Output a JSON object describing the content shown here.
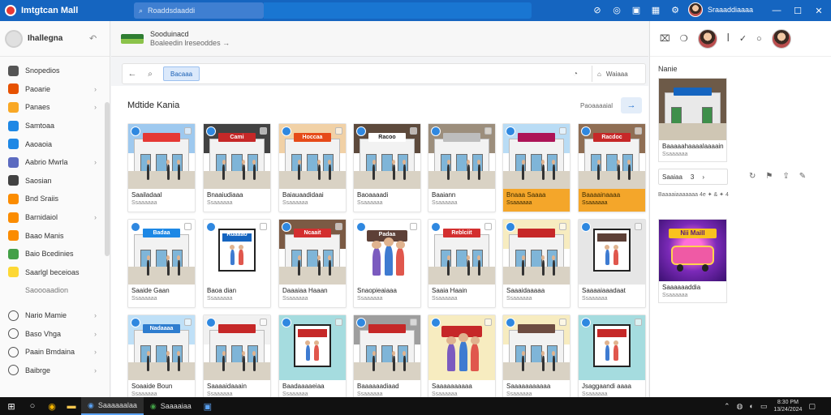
{
  "app": {
    "title": "Imtgtcan Mall"
  },
  "titlebar": {
    "search_text": "Roaddsdaaddi",
    "user_name": "Sraaaddiaaaa",
    "icons": [
      "shield-icon",
      "globe-icon",
      "puzzle-icon",
      "grid-icon",
      "gear-icon"
    ]
  },
  "sidebar": {
    "header": "Ihallegna",
    "items": [
      {
        "label": "Snopedios",
        "icon": "store-icon",
        "color": "#555555",
        "chev": false
      },
      {
        "label": "Paoarie",
        "icon": "person-icon",
        "color": "#e65100",
        "chev": true
      },
      {
        "label": "Panaes",
        "icon": "tag-icon",
        "color": "#f9a825",
        "chev": true
      },
      {
        "label": "Samtoaa",
        "icon": "calendar-icon",
        "color": "#1e88e5",
        "chev": false
      },
      {
        "label": "Aaoaoia",
        "icon": "info-icon",
        "color": "#1e88e5",
        "chev": false
      },
      {
        "label": "Aabrio Mwrla",
        "icon": "grid-icon",
        "color": "#5c6bc0",
        "chev": true
      },
      {
        "label": "Saosian",
        "icon": "people-icon",
        "color": "#424242",
        "chev": false
      },
      {
        "label": "Bnd Sraiis",
        "icon": "list-icon",
        "color": "#fb8c00",
        "chev": false
      },
      {
        "label": "Barnidaiol",
        "icon": "box-icon",
        "color": "#fb8c00",
        "chev": true
      },
      {
        "label": "Baao Manis",
        "icon": "map-icon",
        "color": "#fb8c00",
        "chev": false
      },
      {
        "label": "Baio Bcedinies",
        "icon": "bag-icon",
        "color": "#43a047",
        "chev": false
      },
      {
        "label": "Saarlgl beceioas",
        "icon": "chart-icon",
        "color": "#fdd835",
        "chev": false
      },
      {
        "label": "Saoooaadion",
        "icon": "",
        "color": "",
        "chev": false
      },
      {
        "label": "Nario Mamie",
        "icon": "circle-icon",
        "color": "#555555",
        "chev": true
      },
      {
        "label": "Baso Vhga",
        "icon": "globe-icon",
        "color": "#555555",
        "chev": true
      },
      {
        "label": "Paain Bmdaina",
        "icon": "star-icon",
        "color": "#fb8c00",
        "chev": true
      },
      {
        "label": "Baibrge",
        "icon": "check-icon",
        "color": "#555555",
        "chev": true
      }
    ]
  },
  "main": {
    "header_line1": "Sooduinacd",
    "header_line2": "Boaleedin  lreseoddes  →",
    "filter_chip": "Bacaaa",
    "segment_label": "Waiaaa",
    "section_title": "Mdtide Kania",
    "sort_label": "Paoaaaaial"
  },
  "cards": [
    {
      "title": "Saailadaal",
      "sub": "Ssaaaaaa",
      "sign": "#e53935",
      "sky": "#9ec9ef",
      "sign_text": "",
      "hl": false,
      "art": "store"
    },
    {
      "title": "Bnaaiudiaaa",
      "sub": "Ssaaaaaa",
      "sign": "#c62828",
      "sky": "#424242",
      "sign_text": "Cami",
      "hl": false,
      "art": "store"
    },
    {
      "title": "Baiauaadidaai",
      "sub": "Ssaaaaaa",
      "sign": "#e64a19",
      "sky": "#f1d1a6",
      "sign_text": "Hoccaa",
      "hl": false,
      "art": "store"
    },
    {
      "title": "Baoaaaadi",
      "sub": "Ssaaaaaa",
      "sign": "#ffffff",
      "sky": "#5d4a3c",
      "sign_text": "Racoo",
      "hl": false,
      "art": "store"
    },
    {
      "title": "Baaiann",
      "sub": "Ssaaaaaa",
      "sign": "#bdbdbd",
      "sky": "#9c8e7c",
      "sign_text": "",
      "hl": false,
      "art": "store"
    },
    {
      "title": "Bnaaa Saaaa",
      "sub": "Ssaaaaaa",
      "sign": "#ad1457",
      "sky": "#b9dcf5",
      "sign_text": "",
      "hl": true,
      "art": "store"
    },
    {
      "title": "Baaaainaaaa",
      "sub": "Ssaaaaaa",
      "sign": "#c62828",
      "sky": "#8f6e54",
      "sign_text": "Racdoc",
      "hl": true,
      "art": "store"
    },
    {
      "title": "Saaide Gaan",
      "sub": "Ssaaaaaa",
      "sign": "#1e88e5",
      "sky": "#ffffff",
      "sign_text": "Badaa",
      "hl": false,
      "art": "store"
    },
    {
      "title": "Baoa dian",
      "sub": "Ssaaaaaa",
      "sign": "#1565c0",
      "sky": "#ffffff",
      "sign_text": "Ruaaao",
      "hl": false,
      "art": "poster"
    },
    {
      "title": "Daaaiaa Haaan",
      "sub": "Ssaaaaaa",
      "sign": "#d32f2f",
      "sky": "#7b5a44",
      "sign_text": "Ncaait",
      "hl": false,
      "art": "store"
    },
    {
      "title": "Snaopieaiaaa",
      "sub": "Ssaaaaaa",
      "sign": "#5d4037",
      "sky": "#ffffff",
      "sign_text": "Padaa",
      "hl": false,
      "art": "people"
    },
    {
      "title": "Saaia Haain",
      "sub": "Ssaaaaaa",
      "sign": "#d32f2f",
      "sky": "#ffffff",
      "sign_text": "Reblciit",
      "hl": false,
      "art": "store"
    },
    {
      "title": "Saaaidaaaaa",
      "sub": "Ssaaaaaa",
      "sign": "#c62828",
      "sky": "#f7ecc0",
      "sign_text": "",
      "hl": false,
      "art": "store"
    },
    {
      "title": "Saaaaiaaadaat",
      "sub": "Ssaaaaaa",
      "sign": "#5d4037",
      "sky": "#e6e6e6",
      "sign_text": "",
      "hl": false,
      "art": "poster"
    },
    {
      "title": "Soaaide Boun",
      "sub": "Ssaaaaaa",
      "sign": "#2e7dcf",
      "sky": "#bfe0f7",
      "sign_text": "Nadaaaa",
      "hl": false,
      "art": "store"
    },
    {
      "title": "Saaaaidaaain",
      "sub": "Ssaaaaaa",
      "sign": "#c62828",
      "sky": "#f1f1f1",
      "sign_text": "",
      "hl": false,
      "art": "store"
    },
    {
      "title": "Baadaaaaeiaa",
      "sub": "Ssaaaaaa",
      "sign": "#c62828",
      "sky": "#a5dcdf",
      "sign_text": "",
      "hl": false,
      "art": "poster"
    },
    {
      "title": "Baaaaaadiaad",
      "sub": "Ssaaaaaa",
      "sign": "#c62828",
      "sky": "#9e9e9e",
      "sign_text": "",
      "hl": false,
      "art": "store"
    },
    {
      "title": "Saaaaaaaaaa",
      "sub": "Ssaaaaaa",
      "sign": "#c62828",
      "sky": "#f7ecc0",
      "sign_text": "",
      "hl": false,
      "art": "people"
    },
    {
      "title": "Saaaaaaaaaaa",
      "sub": "Ssaaaaaa",
      "sign": "#6d4c41",
      "sky": "#f7ecc0",
      "sign_text": "",
      "hl": false,
      "art": "store"
    },
    {
      "title": "Jsaggaandi aaaa",
      "sub": "Ssaaaaaa",
      "sign": "#c62828",
      "sky": "#a5dcdf",
      "sign_text": "",
      "hl": false,
      "art": "poster"
    }
  ],
  "right_panel": {
    "label": "Nanie",
    "card1_title": "Baaaaahaaaalaaaain",
    "card1_sub": "Ssaaaaaa",
    "ctrl_label": "Saaiaa",
    "ctrl_value": "3",
    "stats_text": "Baaaaiaaaaaaa 4e ✦ & ✦ 4",
    "card2_sign": "Nii Maill",
    "card2_title": "Saaaaaaddia",
    "card2_sub": "Ssaaaaaa"
  },
  "taskbar": {
    "apps": [
      {
        "label": "Saaaaaalaa",
        "active": true
      },
      {
        "label": "Saaaaiaa",
        "active": false
      }
    ],
    "time": "8:30 PM",
    "date": "13/24/2024"
  }
}
